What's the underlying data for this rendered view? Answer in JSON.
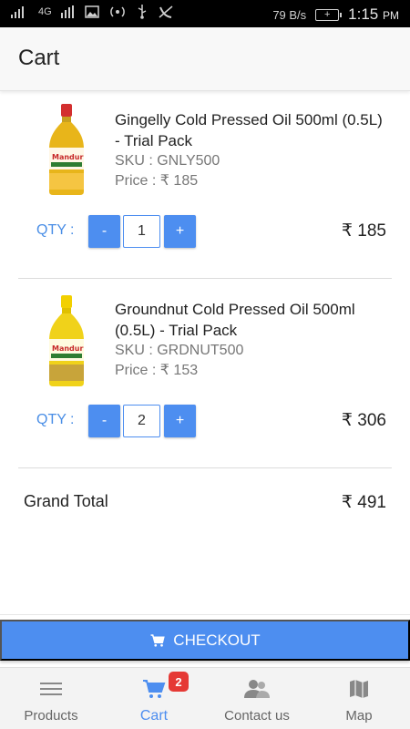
{
  "status_bar": {
    "network": "4G",
    "speed": "79 B/s",
    "time": "1:15",
    "ampm": "PM"
  },
  "header": {
    "title": "Cart"
  },
  "items": [
    {
      "name": "Gingelly Cold Pressed Oil 500ml (0.5L) - Trial Pack",
      "sku": "SKU : GNLY500",
      "price": "Price : ₹ 185",
      "qty_label": "QTY :",
      "minus": "-",
      "qty": "1",
      "plus": "+",
      "line_total": "₹ 185",
      "bottle_cap_color": "#d32f2f",
      "bottle_body_color": "#e8b51a"
    },
    {
      "name": "Groundnut Cold Pressed Oil 500ml (0.5L) - Trial Pack",
      "sku": "SKU : GRDNUT500",
      "price": "Price : ₹ 153",
      "qty_label": "QTY :",
      "minus": "-",
      "qty": "2",
      "plus": "+",
      "line_total": "₹ 306",
      "bottle_cap_color": "#f2d000",
      "bottle_body_color": "#f0d21a"
    }
  ],
  "grand_total": {
    "label": "Grand Total",
    "value": "₹ 491"
  },
  "checkout": {
    "label": "CHECKOUT"
  },
  "bottom_nav": {
    "products": "Products",
    "cart": "Cart",
    "cart_badge": "2",
    "contact": "Contact us",
    "map": "Map"
  },
  "colors": {
    "accent": "#4d8ef0",
    "badge": "#e53935"
  },
  "icons": {
    "products": "menu-lines-icon",
    "cart": "shopping-cart-icon",
    "contact": "people-icon",
    "map": "folded-map-icon"
  }
}
